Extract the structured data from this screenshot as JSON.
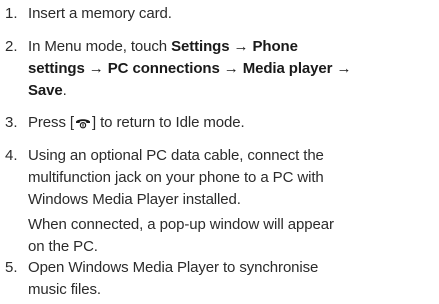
{
  "steps": [
    {
      "number": "1.",
      "text": "Insert a memory card."
    },
    {
      "number": "2.",
      "line1_prefix": "In Menu mode, touch ",
      "line1_bold": "Settings → Phone",
      "line2_bold": "settings → PC connections → Media player →",
      "line3_bold": "Save",
      "line3_suffix": "."
    },
    {
      "number": "3.",
      "prefix": "Press [",
      "key_icon": "end-call-key-icon",
      "suffix": "] to return to Idle mode."
    },
    {
      "number": "4.",
      "line1": "Using an optional PC data cable, connect the",
      "line2": "multifunction jack on your phone to a PC with",
      "line3": "Windows Media Player installed.",
      "para2_line1": "When connected, a pop-up window will appear",
      "para2_line2": "on the PC."
    },
    {
      "number": "5.",
      "line1": "Open Windows Media Player to synchronise",
      "line2": "music files."
    }
  ]
}
